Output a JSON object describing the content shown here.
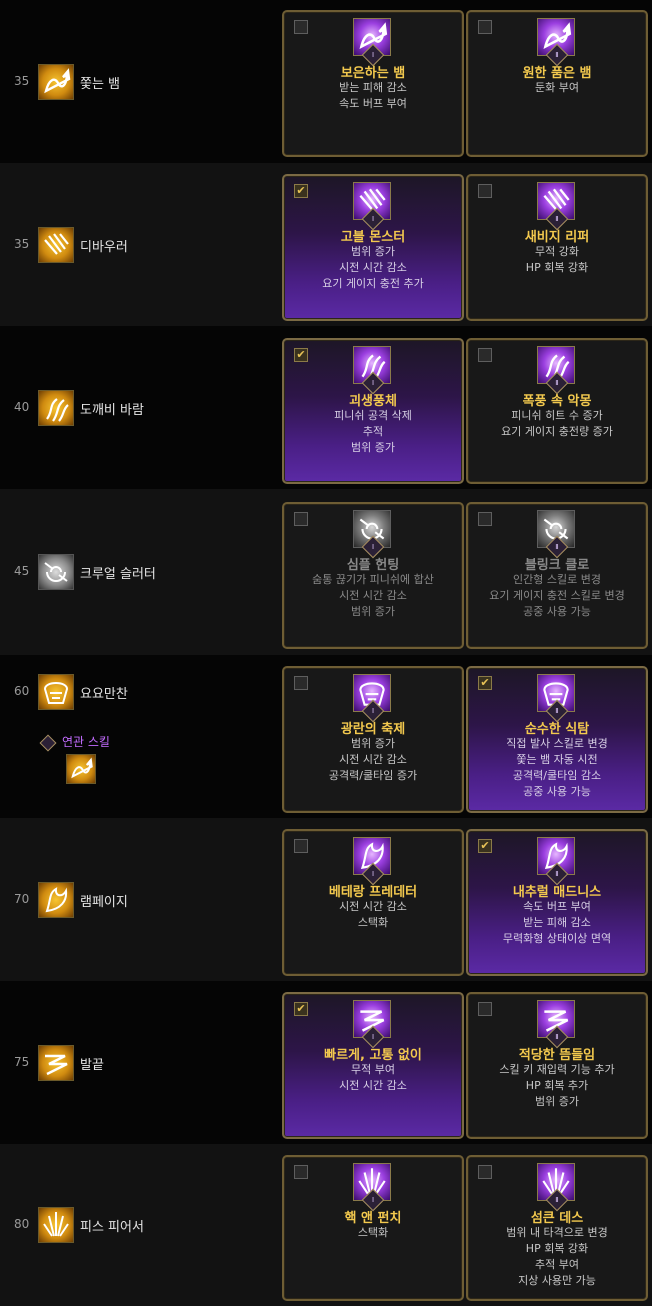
{
  "rows": [
    {
      "level": "35",
      "skill": "쫓는 뱀",
      "icon": "serpent-icon",
      "options": [
        {
          "numeral": "Ⅰ",
          "name": "보은하는 뱀",
          "desc": [
            "받는 피해 감소",
            "속도 버프 부여"
          ],
          "checked": false,
          "icon": "serpent-icon"
        },
        {
          "numeral": "Ⅱ",
          "name": "원한 품은 뱀",
          "desc": [
            "둔화 부여"
          ],
          "checked": false,
          "icon": "serpent-icon"
        }
      ]
    },
    {
      "level": "35",
      "skill": "디바우러",
      "icon": "claw-icon",
      "options": [
        {
          "numeral": "Ⅰ",
          "name": "고블 몬스터",
          "desc": [
            "범위 증가",
            "시전 시간 감소",
            "요기 게이지 충전 추가"
          ],
          "checked": true,
          "icon": "claw-icon"
        },
        {
          "numeral": "Ⅱ",
          "name": "새비지 리퍼",
          "desc": [
            "무적 강화",
            "HP 회복 강화"
          ],
          "checked": false,
          "icon": "claw-icon"
        }
      ]
    },
    {
      "level": "40",
      "skill": "도깨비 바람",
      "icon": "wind-icon",
      "options": [
        {
          "numeral": "Ⅰ",
          "name": "괴생풍체",
          "desc": [
            "피니쉬 공격 삭제",
            "추적",
            "범위 증가"
          ],
          "checked": true,
          "icon": "wind-icon"
        },
        {
          "numeral": "Ⅱ",
          "name": "폭풍 속 악몽",
          "desc": [
            "피니쉬 히트 수 증가",
            "요기 게이지 충전량 증가"
          ],
          "checked": false,
          "icon": "wind-icon"
        }
      ]
    },
    {
      "level": "45",
      "skill": "크루얼 슬러터",
      "icon": "vortex-icon",
      "options": [
        {
          "numeral": "Ⅰ",
          "name": "심플 헌팅",
          "desc": [
            "숨통 끊기가 피니쉬에 합산",
            "시전 시간 감소",
            "범위 증가"
          ],
          "checked": false,
          "icon": "vortex-icon"
        },
        {
          "numeral": "Ⅱ",
          "name": "블링크 클로",
          "desc": [
            "인간형 스킬로 변경",
            "요기 게이지 충전 스킬로 변경",
            "공중 사용 가능"
          ],
          "checked": false,
          "icon": "vortex-icon"
        }
      ]
    },
    {
      "level": "60",
      "skill": "요요만찬",
      "icon": "feast-icon",
      "related_label": "연관 스킬",
      "related_icon": "serpent-icon",
      "options": [
        {
          "numeral": "Ⅰ",
          "name": "광란의 축제",
          "desc": [
            "범위 증가",
            "시전 시간 감소",
            "공격력/쿨타임 증가"
          ],
          "checked": false,
          "icon": "feast-icon"
        },
        {
          "numeral": "Ⅱ",
          "name": "순수한 식탐",
          "desc": [
            "직접 발사 스킬로 변경",
            "쫓는 뱀 자동 시전",
            "공격력/쿨타임 감소",
            "공중 사용 가능"
          ],
          "checked": true,
          "icon": "feast-icon"
        }
      ]
    },
    {
      "level": "70",
      "skill": "램페이지",
      "icon": "rampage-icon",
      "options": [
        {
          "numeral": "Ⅰ",
          "name": "베테랑 프레데터",
          "desc": [
            "시전 시간 감소",
            "스택화"
          ],
          "checked": false,
          "icon": "rampage-icon"
        },
        {
          "numeral": "Ⅱ",
          "name": "내추럴 매드니스",
          "desc": [
            "속도 버프 부여",
            "받는 피해 감소",
            "무력화형 상태이상 면역"
          ],
          "checked": true,
          "icon": "rampage-icon"
        }
      ]
    },
    {
      "level": "75",
      "skill": "발끝",
      "icon": "slash-icon",
      "options": [
        {
          "numeral": "Ⅰ",
          "name": "빠르게, 고통 없이",
          "desc": [
            "무적 부여",
            "시전 시간 감소"
          ],
          "checked": true,
          "icon": "slash-icon"
        },
        {
          "numeral": "Ⅱ",
          "name": "적당한 뜸들임",
          "desc": [
            "스킬 키 재입력 기능 추가",
            "HP 회복 추가",
            "범위 증가"
          ],
          "checked": false,
          "icon": "slash-icon"
        }
      ]
    },
    {
      "level": "80",
      "skill": "피스 피어서",
      "icon": "spike-icon",
      "options": [
        {
          "numeral": "Ⅰ",
          "name": "핵 앤 펀치",
          "desc": [
            "스택화"
          ],
          "checked": false,
          "icon": "spike-icon"
        },
        {
          "numeral": "Ⅱ",
          "name": "섬큰 데스",
          "desc": [
            "범위 내 타격으로 변경",
            "HP 회복 강화",
            "추적 부여",
            "지상 사용만 가능"
          ],
          "checked": false,
          "icon": "spike-icon"
        }
      ]
    }
  ],
  "colors": {
    "gold": "#f3c94e",
    "purple": "#5b2aa5",
    "border": "#6e5d34",
    "related": "#c36cff"
  }
}
